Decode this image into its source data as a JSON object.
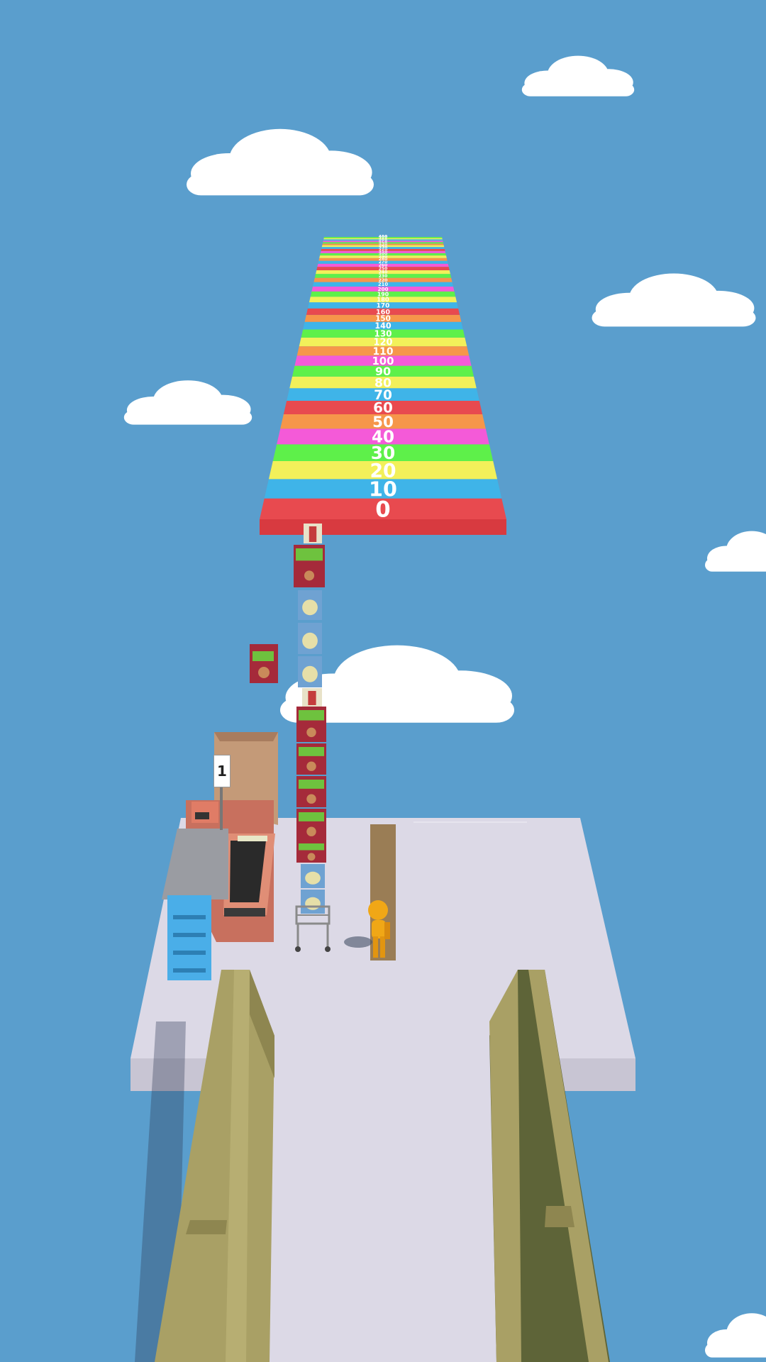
{
  "scoreboard": {
    "stripes": [
      {
        "label": "0",
        "color": "#e84a4f"
      },
      {
        "label": "10",
        "color": "#3fb4e8"
      },
      {
        "label": "20",
        "color": "#f2f05a"
      },
      {
        "label": "30",
        "color": "#5ef04a"
      },
      {
        "label": "40",
        "color": "#f45ad8"
      },
      {
        "label": "50",
        "color": "#f6964a"
      },
      {
        "label": "60",
        "color": "#e84a4f"
      },
      {
        "label": "70",
        "color": "#3fb4e8"
      },
      {
        "label": "80",
        "color": "#f2f05a"
      },
      {
        "label": "90",
        "color": "#5ef04a"
      },
      {
        "label": "100",
        "color": "#f45ad8"
      },
      {
        "label": "110",
        "color": "#f6964a"
      },
      {
        "label": "120",
        "color": "#f2f05a"
      },
      {
        "label": "130",
        "color": "#5ef04a"
      },
      {
        "label": "140",
        "color": "#3fb4e8"
      },
      {
        "label": "150",
        "color": "#f6964a"
      },
      {
        "label": "160",
        "color": "#e84a4f"
      },
      {
        "label": "170",
        "color": "#3fb4e8"
      },
      {
        "label": "180",
        "color": "#f2f05a"
      },
      {
        "label": "190",
        "color": "#5ef04a"
      },
      {
        "label": "200",
        "color": "#f45ad8"
      },
      {
        "label": "210",
        "color": "#3fb4e8"
      },
      {
        "label": "220",
        "color": "#f6964a"
      },
      {
        "label": "230",
        "color": "#5ef04a"
      },
      {
        "label": "240",
        "color": "#f2f05a"
      },
      {
        "label": "250",
        "color": "#e84a4f"
      },
      {
        "label": "260",
        "color": "#f45ad8"
      },
      {
        "label": "270",
        "color": "#3fb4e8"
      },
      {
        "label": "280",
        "color": "#f6964a"
      },
      {
        "label": "290",
        "color": "#f2f05a"
      },
      {
        "label": "300",
        "color": "#5ef04a"
      },
      {
        "label": "310",
        "color": "#f45ad8"
      },
      {
        "label": "320",
        "color": "#e84a4f"
      },
      {
        "label": "330",
        "color": "#3fb4e8"
      },
      {
        "label": "340",
        "color": "#f2f05a"
      },
      {
        "label": "350",
        "color": "#f6964a"
      },
      {
        "label": "360",
        "color": "#5ef04a"
      },
      {
        "label": "370",
        "color": "#f45ad8"
      },
      {
        "label": "380",
        "color": "#3fb4e8"
      },
      {
        "label": "390",
        "color": "#f2f05a"
      },
      {
        "label": "400",
        "color": "#5ef04a"
      }
    ]
  },
  "checkout": {
    "lane_number": "1"
  },
  "stack": {
    "items": [
      "popcorn",
      "chips-red",
      "chips-blue",
      "chips-blue",
      "chips-blue",
      "popcorn",
      "chips-red",
      "chips-red",
      "chips-red",
      "chips-red",
      "chips-red",
      "chips-blue",
      "chips-blue"
    ]
  },
  "colors": {
    "sky": "#5a9ecd",
    "floor": "#dcd9e6",
    "railing": "#a9a065",
    "player": "#f0a716",
    "chips_red": "#a52a3a",
    "chips_blue": "#6fa2d2"
  }
}
